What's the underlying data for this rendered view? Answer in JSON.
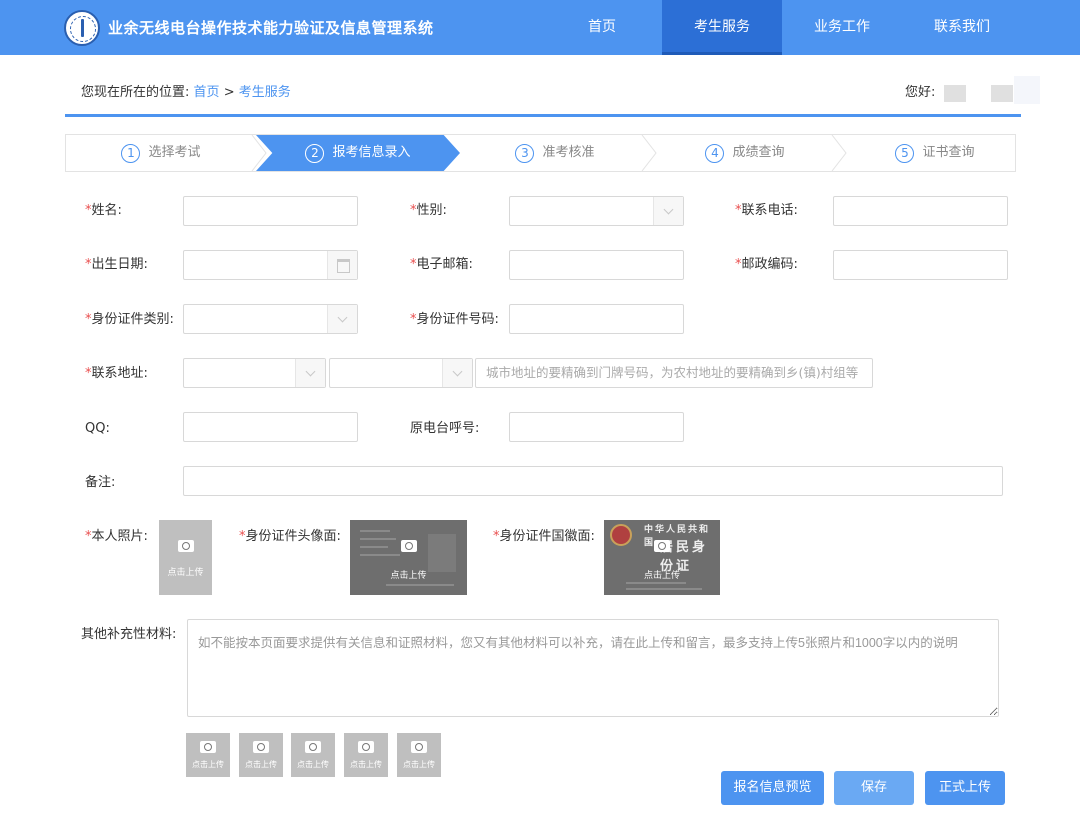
{
  "header": {
    "system_title": "业余无线电台操作技术能力验证及信息管理系统",
    "nav": [
      "首页",
      "考生服务",
      "业务工作",
      "联系我们"
    ],
    "active_nav": "考生服务"
  },
  "breadcrumb": {
    "prefix": "您现在所在的位置:",
    "home": "首页",
    "separator": ">",
    "current": "考生服务"
  },
  "greeting": "您好:",
  "steps": [
    {
      "num": "1",
      "label": "选择考试"
    },
    {
      "num": "2",
      "label": "报考信息录入"
    },
    {
      "num": "3",
      "label": "准考核准"
    },
    {
      "num": "4",
      "label": "成绩查询"
    },
    {
      "num": "5",
      "label": "证书查询"
    }
  ],
  "active_step": 2,
  "form": {
    "required_mark": "*",
    "name_label": "姓名:",
    "gender_label": "性别:",
    "phone_label": "联系电话:",
    "birth_label": "出生日期:",
    "email_label": "电子邮箱:",
    "postcode_label": "邮政编码:",
    "id_type_label": "身份证件类别:",
    "id_number_label": "身份证件号码:",
    "address_label": "联系地址:",
    "address_placeholder": "城市地址的要精确到门牌号码，为农村地址的要精确到乡(镇)村组等",
    "qq_label": "QQ:",
    "callsign_label": "原电台呼号:",
    "remark_label": "备注:"
  },
  "uploads": {
    "photo_label": "本人照片:",
    "id_front_label": "身份证件头像面:",
    "id_back_label": "身份证件国徽面:",
    "upload_caption": "点击上传",
    "id_back_card_title": "中华人民共和国",
    "id_back_card_name": "居民身份证",
    "other_label": "其他补充性材料:",
    "other_placeholder": "如不能按本页面要求提供有关信息和证照材料，您又有其他材料可以补充，请在此上传和留言，最多支持上传5张照片和1000字以内的说明"
  },
  "buttons": {
    "preview": "报名信息预览",
    "save": "保存",
    "submit": "正式上传"
  },
  "colors": {
    "primary": "#4d94f0",
    "nav_active": "#2c6fd6",
    "required": "#e94e4e",
    "upload_placeholder": "#bfbfbf"
  }
}
